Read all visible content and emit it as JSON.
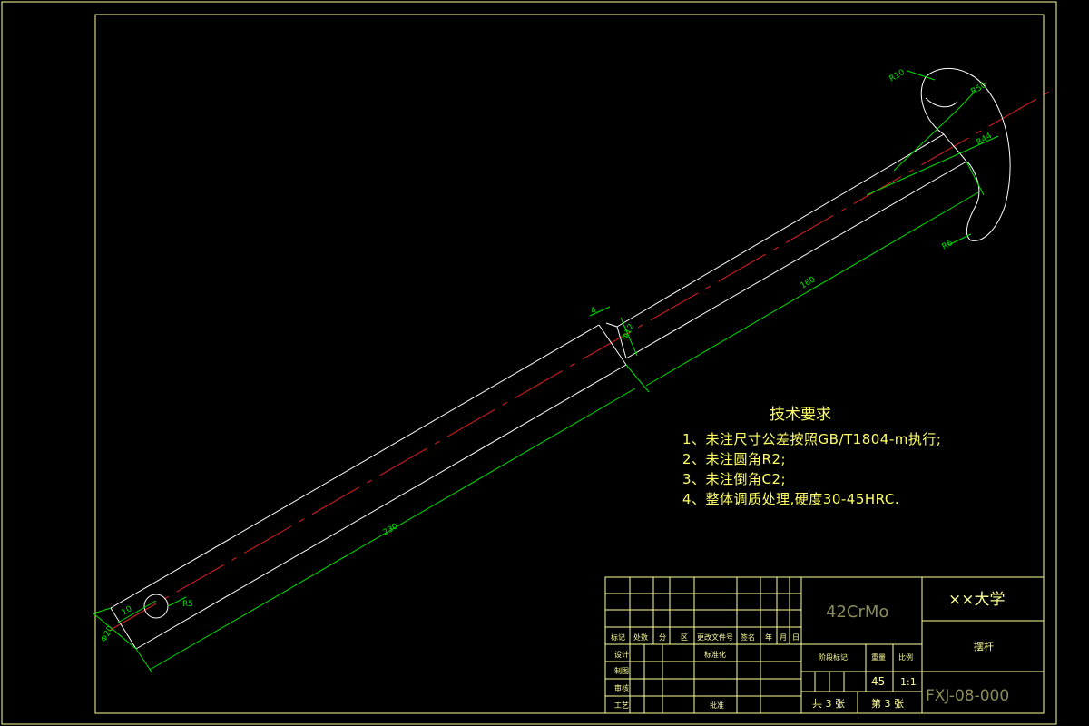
{
  "drawing": {
    "dimensions": {
      "d1": "R10",
      "d2": "R50",
      "d3": "R44",
      "d4": "R6",
      "d5": "160",
      "d6": "4",
      "d7": "Φ12",
      "d8": "230",
      "d9": "10",
      "d10": "R5",
      "d11": "Φ20"
    },
    "tech_requirements": {
      "title": "技术要求",
      "items": [
        "1、未注尺寸公差按照GB/T1804-m执行;",
        "2、未注圆角R2;",
        "3、未注倒角C2;",
        "4、整体调质处理,硬度30-45HRC."
      ]
    }
  },
  "title_block": {
    "material": "42CrMo",
    "school": "××大学",
    "part_name": "摆杆",
    "drawing_no": "FXJ-08-000",
    "row_labels": [
      "标记",
      "处数",
      "分",
      "区",
      "更改文件号",
      "签名",
      "年",
      "月",
      "日"
    ],
    "design": "设计",
    "standardize": "标准化",
    "draw": "制图",
    "review": "审核",
    "craft": "工艺",
    "approve": "批准",
    "stage_mark": "阶段标记",
    "weight_label": "重量",
    "scale_label": "比例",
    "weight": "45",
    "scale": "1:1",
    "total_sheets": "共 3 张",
    "sheet_no": "第 3 张"
  },
  "colors": {
    "background": "#000000",
    "outline": "#ffffff",
    "dimension": "#00e000",
    "centerline": "#e02020",
    "text_yellow": "#ffff66",
    "frame": "#ffff99"
  }
}
